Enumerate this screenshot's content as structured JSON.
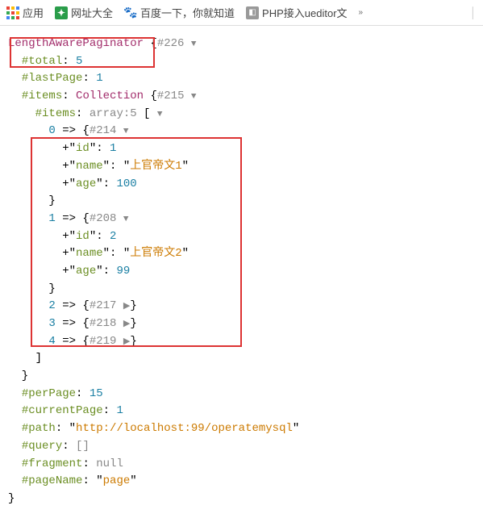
{
  "bookmarks": {
    "apps": "应用",
    "item1": "网址大全",
    "item2": "百度一下，你就知道",
    "item3": "PHP接入ueditor文"
  },
  "dump": {
    "className": "LengthAwarePaginator",
    "classHash": "#226",
    "total": {
      "key": "#total",
      "value": "5"
    },
    "lastPage": {
      "key": "#lastPage",
      "value": "1"
    },
    "items": {
      "key": "#items",
      "type": "Collection",
      "hash": "#215",
      "innerKey": "#items",
      "innerType": "array:5",
      "rows": [
        {
          "idx": "0",
          "hash": "#214",
          "expanded": true,
          "fields": [
            {
              "k": "id",
              "v": "1"
            },
            {
              "k": "name",
              "v": "上官帝文1",
              "isStr": true
            },
            {
              "k": "age",
              "v": "100"
            }
          ]
        },
        {
          "idx": "1",
          "hash": "#208",
          "expanded": true,
          "fields": [
            {
              "k": "id",
              "v": "2"
            },
            {
              "k": "name",
              "v": "上官帝文2",
              "isStr": true
            },
            {
              "k": "age",
              "v": "99"
            }
          ]
        },
        {
          "idx": "2",
          "hash": "#217",
          "expanded": false
        },
        {
          "idx": "3",
          "hash": "#218",
          "expanded": false
        },
        {
          "idx": "4",
          "hash": "#219",
          "expanded": false
        }
      ]
    },
    "perPage": {
      "key": "#perPage",
      "value": "15"
    },
    "currentPage": {
      "key": "#currentPage",
      "value": "1"
    },
    "path": {
      "key": "#path",
      "value": "http://localhost:99/operatemysql"
    },
    "query": {
      "key": "#query",
      "value": "[]"
    },
    "fragment": {
      "key": "#fragment",
      "value": "null"
    },
    "pageName": {
      "key": "#pageName",
      "value": "page"
    }
  }
}
